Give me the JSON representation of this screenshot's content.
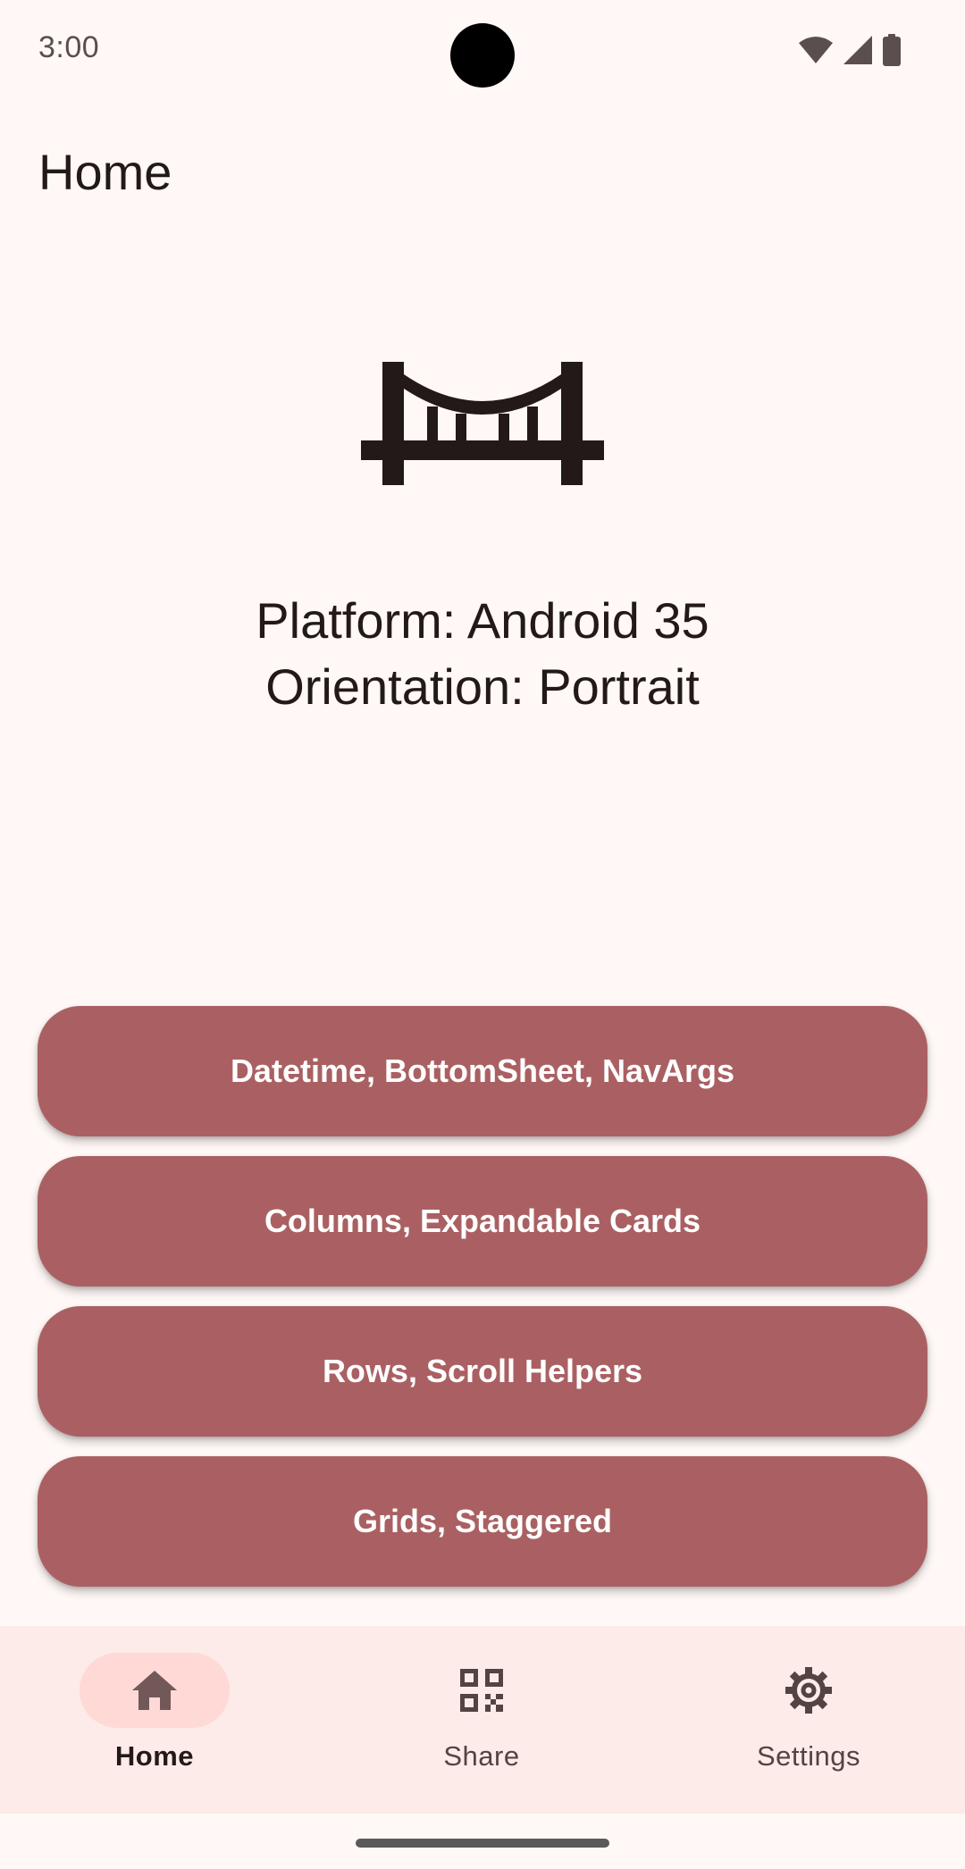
{
  "status_bar": {
    "time": "3:00",
    "icons": [
      "wifi-icon",
      "cell-signal-icon",
      "battery-icon"
    ]
  },
  "app_bar": {
    "title": "Home"
  },
  "hero": {
    "icon": "bridge-icon",
    "platform": "Platform: Android 35",
    "orientation": "Orientation: Portrait"
  },
  "buttons": [
    {
      "label": "Datetime, BottomSheet, NavArgs"
    },
    {
      "label": "Columns, Expandable Cards"
    },
    {
      "label": "Rows, Scroll Helpers"
    },
    {
      "label": "Grids, Staggered"
    }
  ],
  "bottom_nav": {
    "items": [
      {
        "label": "Home",
        "icon": "home-icon",
        "selected": true
      },
      {
        "label": "Share",
        "icon": "qr-code-icon",
        "selected": false
      },
      {
        "label": "Settings",
        "icon": "gear-icon",
        "selected": false
      }
    ]
  },
  "colors": {
    "background": "#fff8f6",
    "button": "#aa6062",
    "nav_background": "#fcebe8",
    "nav_active_pill": "#ffd9d6"
  }
}
